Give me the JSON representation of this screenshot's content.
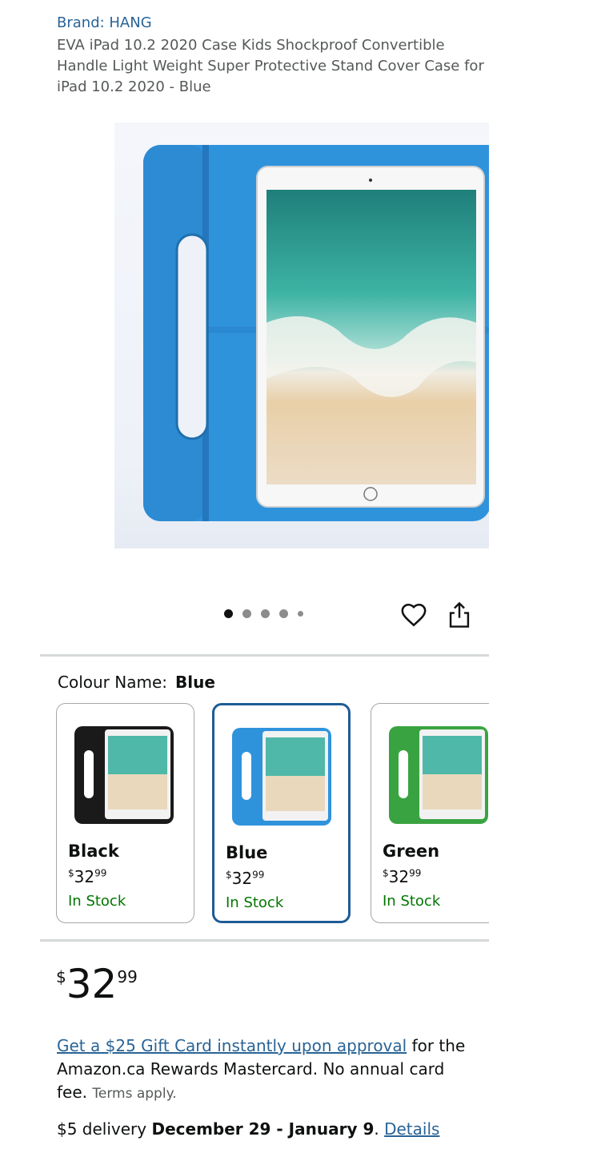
{
  "product": {
    "brand": "Brand: HANG",
    "title": "EVA iPad 10.2 2020 Case Kids Shockproof Convertible Handle Light Weight Super Protective Stand Cover Case for iPad 10.2 2020 - Blue"
  },
  "gallery": {
    "image_count": 5,
    "active_index": 0
  },
  "actions": {
    "wishlist_icon": "heart-icon",
    "share_icon": "share-icon"
  },
  "colour": {
    "label": "Colour Name:",
    "selected": "Blue",
    "options": [
      {
        "name": "Black",
        "currency": "$",
        "whole": "32",
        "fraction": "99",
        "stock": "In Stock",
        "color": "#1a1a1a"
      },
      {
        "name": "Blue",
        "currency": "$",
        "whole": "32",
        "fraction": "99",
        "stock": "In Stock",
        "color": "#2f93dc"
      },
      {
        "name": "Green",
        "currency": "$",
        "whole": "32",
        "fraction": "99",
        "stock": "In Stock",
        "color": "#3aa341"
      }
    ]
  },
  "price": {
    "currency": "$",
    "whole": "32",
    "fraction": "99"
  },
  "promo": {
    "link": "Get a $25 Gift Card instantly upon approval",
    "text": " for the Amazon.ca Rewards Mastercard. No annual card fee. ",
    "terms": "Terms apply."
  },
  "delivery": {
    "prefix": "$5 delivery ",
    "dates": "December 29 - January 9",
    "suffix": ". ",
    "details": "Details"
  },
  "colors": {
    "link": "#2a6496",
    "in_stock": "#007600",
    "selected_border": "#1e5c96",
    "case_blue": "#2f93dc"
  }
}
